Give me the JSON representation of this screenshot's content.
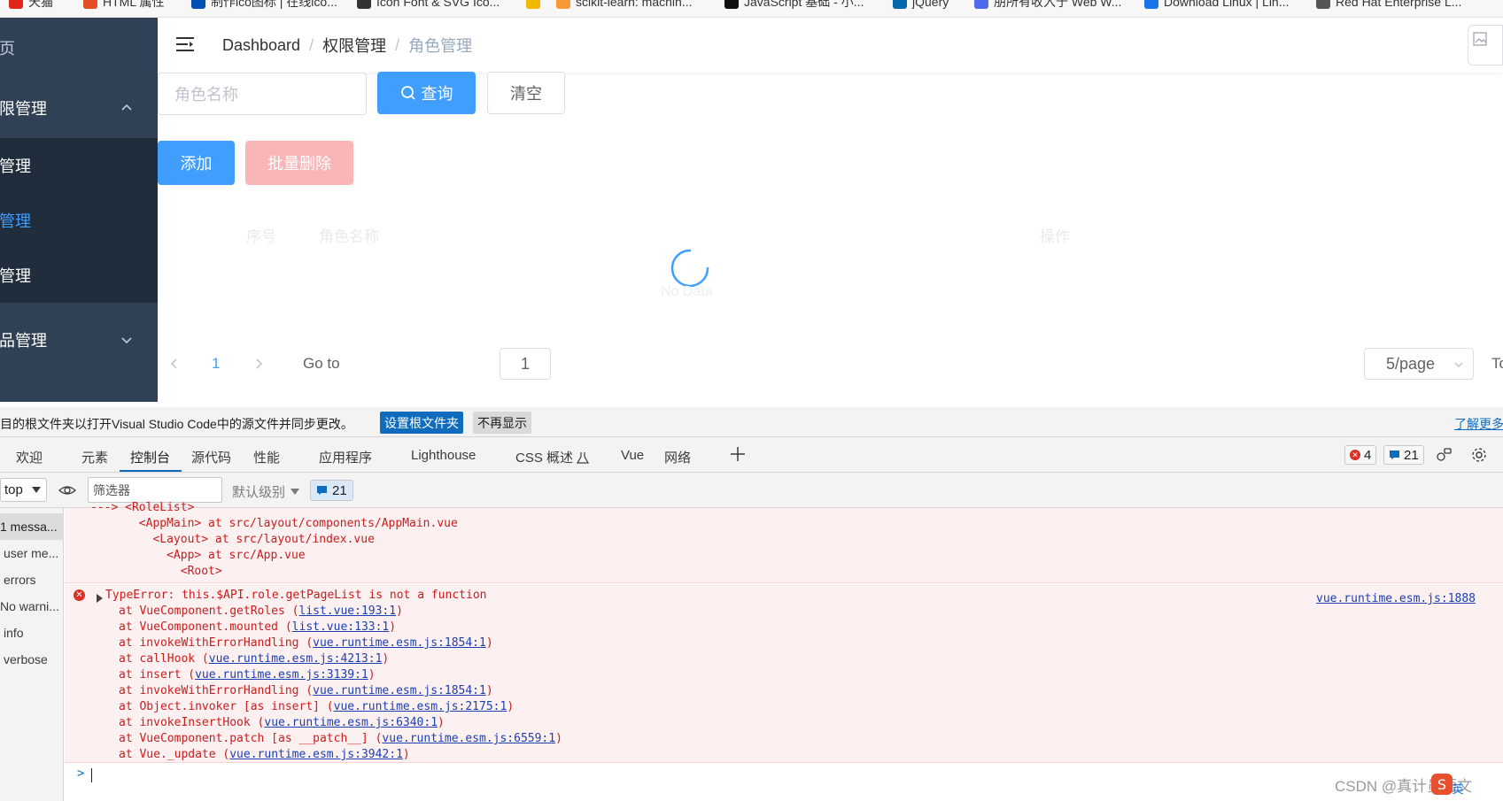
{
  "bookmarks": [
    {
      "label": "天猫",
      "color": "#e1251b"
    },
    {
      "label": "HTML 属性",
      "color": "#e44d26"
    },
    {
      "label": "制作ico图标 | 在线ico...",
      "color": "#0050b3"
    },
    {
      "label": "Icon Font & SVG Ico...",
      "color": "#333333"
    },
    {
      "label": "",
      "color": "#f2b800"
    },
    {
      "label": "scikit-learn: machin...",
      "color": "#f89939"
    },
    {
      "label": "JavaScript 基础 - 小...",
      "color": "#111111"
    },
    {
      "label": "jQuery",
      "color": "#0769ad"
    },
    {
      "label": "朋所有收入于 Web W...",
      "color": "#4f6bed"
    },
    {
      "label": "Download Linux | Lin...",
      "color": "#1a73e8"
    },
    {
      "label": "Red Hat Enterprise L...",
      "color": "#555555"
    }
  ],
  "sidebar": {
    "items": [
      {
        "label": "页"
      },
      {
        "label": "限管理"
      },
      {
        "label": "管理"
      },
      {
        "label": "管理"
      },
      {
        "label": "管理"
      },
      {
        "label": "品管理"
      }
    ]
  },
  "header": {
    "breadcrumb": [
      "Dashboard",
      "权限管理",
      "角色管理"
    ],
    "separator": "/"
  },
  "search": {
    "placeholder": "角色名称",
    "query_label": "查询",
    "clear_label": "清空"
  },
  "actions": {
    "add_label": "添加",
    "batch_delete_label": "批量删除"
  },
  "table": {
    "columns": [
      "序号",
      "角色名称",
      "操作"
    ],
    "empty_text": "No Data"
  },
  "pagination": {
    "current_page": "1",
    "goto_label": "Go to",
    "goto_value": "1",
    "page_size": "5/page",
    "total_label": "To"
  },
  "notice": {
    "message": "目的根文件夹以打开Visual Studio Code中的源文件并同步更改。",
    "set_root_label": "设置根文件夹",
    "dismiss_label": "不再显示",
    "learn_more_label": "了解更多"
  },
  "devtools": {
    "tabs": [
      "欢迎",
      "元素",
      "控制台",
      "源代码",
      "性能",
      "应用程序",
      "Lighthouse",
      "CSS 概述",
      "Vue",
      "网络"
    ],
    "active_tab": "控制台",
    "error_count": "4",
    "issue_count": "21"
  },
  "console": {
    "context": "top",
    "filter_placeholder": "筛选器",
    "level_label": "默认级别",
    "issues_count": "21",
    "sidebar": [
      "1 messa...",
      "user me...",
      "errors",
      "No warni...",
      "info",
      "verbose"
    ],
    "trace_lines": [
      "---> <RoleList>",
      "       <AppMain> at src/layout/components/AppMain.vue",
      "         <Layout> at src/layout/index.vue",
      "           <App> at src/App.vue",
      "             <Root>"
    ],
    "error_message": "TypeError: this.$API.role.getPageList is not a function",
    "error_source": "vue.runtime.esm.js:1888",
    "stack": [
      {
        "prefix": "at VueComponent.getRoles (",
        "link": "list.vue:193:1",
        "suffix": ")"
      },
      {
        "prefix": "at VueComponent.mounted (",
        "link": "list.vue:133:1",
        "suffix": ")"
      },
      {
        "prefix": "at invokeWithErrorHandling (",
        "link": "vue.runtime.esm.js:1854:1",
        "suffix": ")"
      },
      {
        "prefix": "at callHook (",
        "link": "vue.runtime.esm.js:4213:1",
        "suffix": ")"
      },
      {
        "prefix": "at insert (",
        "link": "vue.runtime.esm.js:3139:1",
        "suffix": ")"
      },
      {
        "prefix": "at invokeWithErrorHandling (",
        "link": "vue.runtime.esm.js:1854:1",
        "suffix": ")"
      },
      {
        "prefix": "at Object.invoker [as insert] (",
        "link": "vue.runtime.esm.js:2175:1",
        "suffix": ")"
      },
      {
        "prefix": "at invokeInsertHook (",
        "link": "vue.runtime.esm.js:6340:1",
        "suffix": ")"
      },
      {
        "prefix": "at VueComponent.patch [as __patch__] (",
        "link": "vue.runtime.esm.js:6559:1",
        "suffix": ")"
      },
      {
        "prefix": "at Vue._update (",
        "link": "vue.runtime.esm.js:3942:1",
        "suffix": ")"
      }
    ],
    "prompt_symbol": ">"
  },
  "watermark": "CSDN @真计员语文",
  "colors": {
    "sidebar_bg": "#304156",
    "sidebar_submenu_bg": "#1f2d3d",
    "primary": "#409eff",
    "danger_disabled": "#fab6b6",
    "error_red": "#c81e1e",
    "error_bg": "#fdf0f0"
  }
}
